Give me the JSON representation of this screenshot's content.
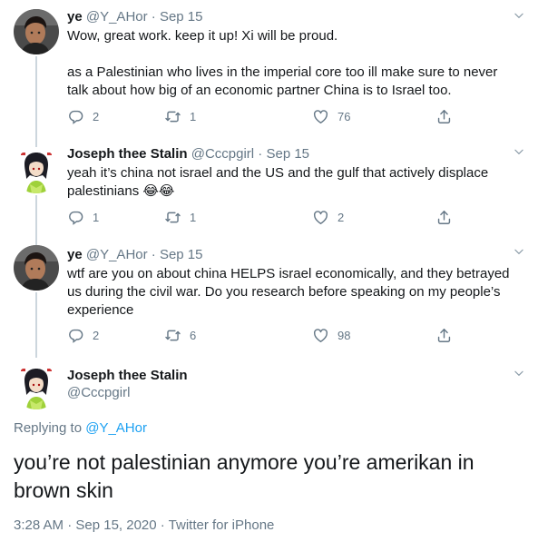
{
  "tweets": [
    {
      "name": "ye",
      "handle": "@Y_AHor",
      "separator": "·",
      "date": "Sep 15",
      "text1": "Wow, great work. keep it up! Xi will be proud.",
      "text2": "as a Palestinian who lives in the imperial core too ill make sure to never talk about how big of an economic partner China is to Israel too.",
      "replies": "2",
      "retweets": "1",
      "likes": "76"
    },
    {
      "name": "Joseph thee Stalin",
      "handle": "@Cccpgirl",
      "separator": "·",
      "date": "Sep 15",
      "text1": "yeah it’s china not israel and the US and the gulf that actively displace palestinians 😂😂",
      "replies": "1",
      "retweets": "1",
      "likes": "2"
    },
    {
      "name": "ye",
      "handle": "@Y_AHor",
      "separator": "·",
      "date": "Sep 15",
      "text1": "wtf are you on about china HELPS israel economically, and they betrayed us during the civil war. Do you research before speaking on my people’s experience",
      "replies": "2",
      "retweets": "6",
      "likes": "98"
    }
  ],
  "main_tweet": {
    "name": "Joseph thee Stalin",
    "handle": "@Cccpgirl",
    "replying_prefix": "Replying to",
    "replying_to": "@Y_AHor",
    "text": "you’re not palestinian anymore you’re amerikan in brown skin",
    "meta": "3:28 AM · Sep 15, 2020 · Twitter for iPhone"
  },
  "colors": {
    "link": "#1da1f2",
    "secondary_text": "#657786",
    "thread_line": "#ccd6dd"
  },
  "icons": [
    "reply-icon",
    "retweet-icon",
    "like-icon",
    "share-icon",
    "chevron-down-icon"
  ]
}
